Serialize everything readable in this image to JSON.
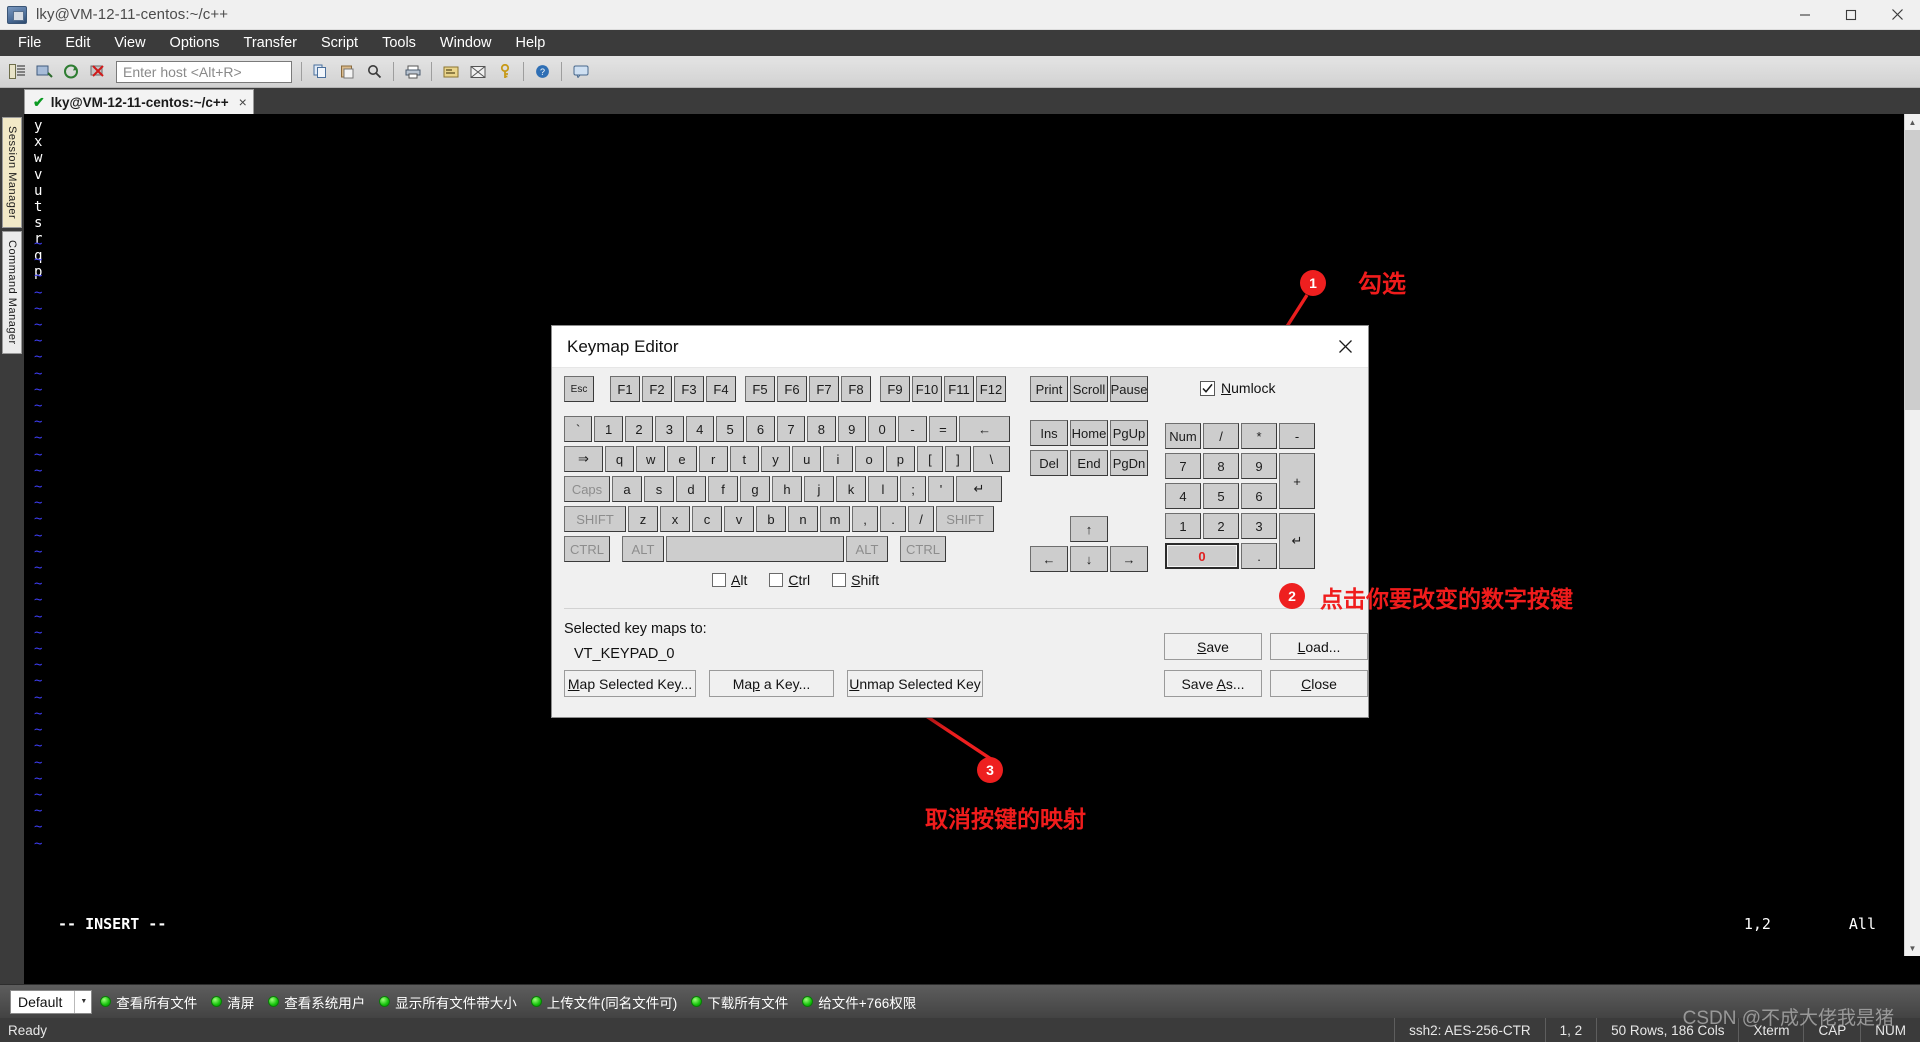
{
  "window": {
    "title": "lky@VM-12-11-centos:~/c++",
    "icon": "securecrt-app-icon",
    "buttons": {
      "minimize": "minimize-icon",
      "maximize": "maximize-icon",
      "close": "close-icon"
    }
  },
  "menubar": {
    "items": [
      "File",
      "Edit",
      "View",
      "Options",
      "Transfer",
      "Script",
      "Tools",
      "Window",
      "Help"
    ]
  },
  "toolbar": {
    "icons": [
      "session-manager-icon",
      "connect-icon",
      "reconnect-icon",
      "disconnect-icon"
    ],
    "host_placeholder": "Enter host <Alt+R>",
    "icons2": [
      "copy-icon",
      "paste-icon",
      "find-icon",
      "print-icon",
      "properties-icon",
      "options-icon",
      "key-icon",
      "help-icon",
      "chat-icon"
    ]
  },
  "tab": {
    "label": "lky@VM-12-11-centos:~/c++",
    "status": "connected",
    "close": "×"
  },
  "rails": {
    "session_manager": "Session Manager",
    "command_manager": "Command Manager"
  },
  "terminal": {
    "left_column": [
      "y",
      "x",
      "w",
      "v",
      "u",
      "t",
      "s",
      "r",
      "q",
      "p"
    ],
    "tilde_rows": 38,
    "status_mode": "-- INSERT --",
    "cursor_pos": "1,2",
    "scroll_pos": "All"
  },
  "dialog": {
    "title": "Keymap Editor",
    "close_icon": "close-icon",
    "function_row": [
      "Esc",
      "F1",
      "F2",
      "F3",
      "F4",
      "F5",
      "F6",
      "F7",
      "F8",
      "F9",
      "F10",
      "F11",
      "F12"
    ],
    "number_row": [
      "`",
      "1",
      "2",
      "3",
      "4",
      "5",
      "6",
      "7",
      "8",
      "9",
      "0",
      "-",
      "=",
      "←"
    ],
    "top_row": [
      "⇒",
      "q",
      "w",
      "e",
      "r",
      "t",
      "y",
      "u",
      "i",
      "o",
      "p",
      "[",
      "]",
      "\\"
    ],
    "home_row": [
      "Caps",
      "a",
      "s",
      "d",
      "f",
      "g",
      "h",
      "j",
      "k",
      "l",
      ";",
      "'",
      "↵"
    ],
    "shift_row": [
      "SHIFT",
      "z",
      "x",
      "c",
      "v",
      "b",
      "n",
      "m",
      ",",
      ".",
      "/",
      "SHIFT"
    ],
    "ctrl_row": [
      "CTRL",
      "ALT",
      "",
      "ALT",
      "CTRL"
    ],
    "nav_top": [
      "Print",
      "Scroll",
      "Pause"
    ],
    "nav_mid": [
      "Ins",
      "Home",
      "PgUp",
      "Del",
      "End",
      "PgDn"
    ],
    "arrows": [
      "↑",
      "←",
      "↓",
      "→"
    ],
    "numpad": [
      "Num",
      "/",
      "*",
      "-",
      "7",
      "8",
      "9",
      "+",
      "4",
      "5",
      "6",
      "1",
      "2",
      "3",
      "↵",
      "0",
      "."
    ],
    "numpad_selected": "0",
    "numlock": {
      "label": "Numlock",
      "underline": "N",
      "checked": true
    },
    "modifiers": [
      {
        "label": "Alt",
        "underline": "A",
        "checked": false
      },
      {
        "label": "Ctrl",
        "underline": "C",
        "checked": false
      },
      {
        "label": "Shift",
        "underline": "S",
        "checked": false
      }
    ],
    "selected_label": "Selected key maps to:",
    "selected_value": "VT_KEYPAD_0",
    "buttons": {
      "map_selected": "Map Selected Key...",
      "map_a_key": "Map a Key...",
      "unmap_selected": "Unmap Selected Key",
      "save": "Save",
      "load": "Load...",
      "save_as": "Save As...",
      "close": "Close"
    }
  },
  "annotations": [
    {
      "num": "1",
      "text": "勾选"
    },
    {
      "num": "2",
      "text": "点击你要改变的数字按键"
    },
    {
      "num": "3",
      "text": "取消按键的映射"
    }
  ],
  "buttonbar": {
    "profile": "Default",
    "items": [
      "查看所有文件",
      "清屏",
      "查看系统用户",
      "显示所有文件带大小",
      "上传文件(同名文件可)",
      "下载所有文件",
      "给文件+766权限"
    ]
  },
  "statusbar": {
    "ready": "Ready",
    "cells": [
      "ssh2: AES-256-CTR",
      "1,  2",
      "50 Rows, 186 Cols",
      "Xterm",
      "CAP",
      "NUM"
    ]
  },
  "watermark": "CSDN @不成大佬我是猪",
  "colors": {
    "accent_red": "#ee1f1f",
    "terminal_bg": "#000000",
    "menu_bg": "#3b3b3b",
    "dialog_bg": "#f0f0f0",
    "key_bg": "#cdcdcd",
    "green_dot": "#16c40c"
  }
}
